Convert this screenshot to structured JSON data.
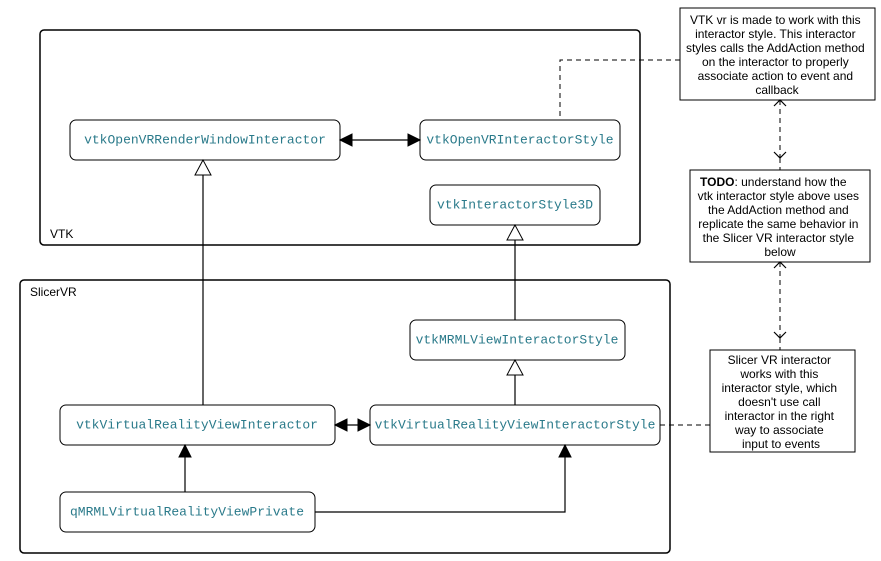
{
  "containers": {
    "vtk": {
      "label": "VTK"
    },
    "slicervr": {
      "label": "SlicerVR"
    }
  },
  "classes": {
    "interactor_vtk": "vtkOpenVRRenderWindowInteractor",
    "style_vtk": "vtkOpenVRInteractorStyle",
    "style3d": "vtkInteractorStyle3D",
    "mrml_style": "vtkMRMLViewInteractorStyle",
    "vr_interactor": "vtkVirtualRealityViewInteractor",
    "vr_style": "vtkVirtualRealityViewInteractorStyle",
    "view_private": "qMRMLVirtualRealityViewPrivate"
  },
  "notes": {
    "top": {
      "l1": "VTK vr is made to work with this",
      "l2": "interactor style. This interactor",
      "l3": "styles calls the AddAction method",
      "l4": "on the interactor to properly",
      "l5": "associate action to event and",
      "l6": "callback"
    },
    "mid": {
      "l1b": "TODO",
      "l1": ": understand how the",
      "l2": "vtk interactor style above uses",
      "l3": "the AddAction method and",
      "l4": "replicate the same behavior in",
      "l5": "the Slicer VR interactor style",
      "l6": "below"
    },
    "bot": {
      "l1": "Slicer VR interactor",
      "l2": "works with this",
      "l3": "interactor style, which",
      "l4": "doesn't use call",
      "l5": "interactor in the right",
      "l6": "way to associate",
      "l7": "input to events"
    }
  },
  "chart_data": {
    "type": "class-diagram",
    "packages": [
      {
        "name": "VTK",
        "classes": [
          "vtkOpenVRRenderWindowInteractor",
          "vtkOpenVRInteractorStyle",
          "vtkInteractorStyle3D"
        ]
      },
      {
        "name": "SlicerVR",
        "classes": [
          "vtkMRMLViewInteractorStyle",
          "vtkVirtualRealityViewInteractor",
          "vtkVirtualRealityViewInteractorStyle",
          "qMRMLVirtualRealityViewPrivate"
        ]
      }
    ],
    "inheritance": [
      {
        "child": "vtkVirtualRealityViewInteractor",
        "parent": "vtkOpenVRRenderWindowInteractor"
      },
      {
        "child": "vtkMRMLViewInteractorStyle",
        "parent": "vtkInteractorStyle3D"
      },
      {
        "child": "vtkVirtualRealityViewInteractorStyle",
        "parent": "vtkMRMLViewInteractorStyle"
      }
    ],
    "bidirectional_associations": [
      [
        "vtkOpenVRRenderWindowInteractor",
        "vtkOpenVRInteractorStyle"
      ],
      [
        "vtkVirtualRealityViewInteractor",
        "vtkVirtualRealityViewInteractorStyle"
      ]
    ],
    "directed_associations": [
      {
        "from": "qMRMLVirtualRealityViewPrivate",
        "to": "vtkVirtualRealityViewInteractor"
      },
      {
        "from": "qMRMLVirtualRealityViewPrivate",
        "to": "vtkVirtualRealityViewInteractorStyle"
      }
    ],
    "notes": [
      {
        "text": "VTK vr is made to work with this interactor style. This interactor styles calls the AddAction method on the interactor to properly associate action to event and callback",
        "attached_to": "vtkOpenVRInteractorStyle"
      },
      {
        "text": "TODO: understand how the vtk interactor style above uses the AddAction method and replicate the same behavior in the Slicer VR interactor style below"
      },
      {
        "text": "Slicer VR interactor works with this interactor style, which doesn't use call interactor in the right way to associate input to events",
        "attached_to": "vtkVirtualRealityViewInteractorStyle"
      }
    ]
  }
}
